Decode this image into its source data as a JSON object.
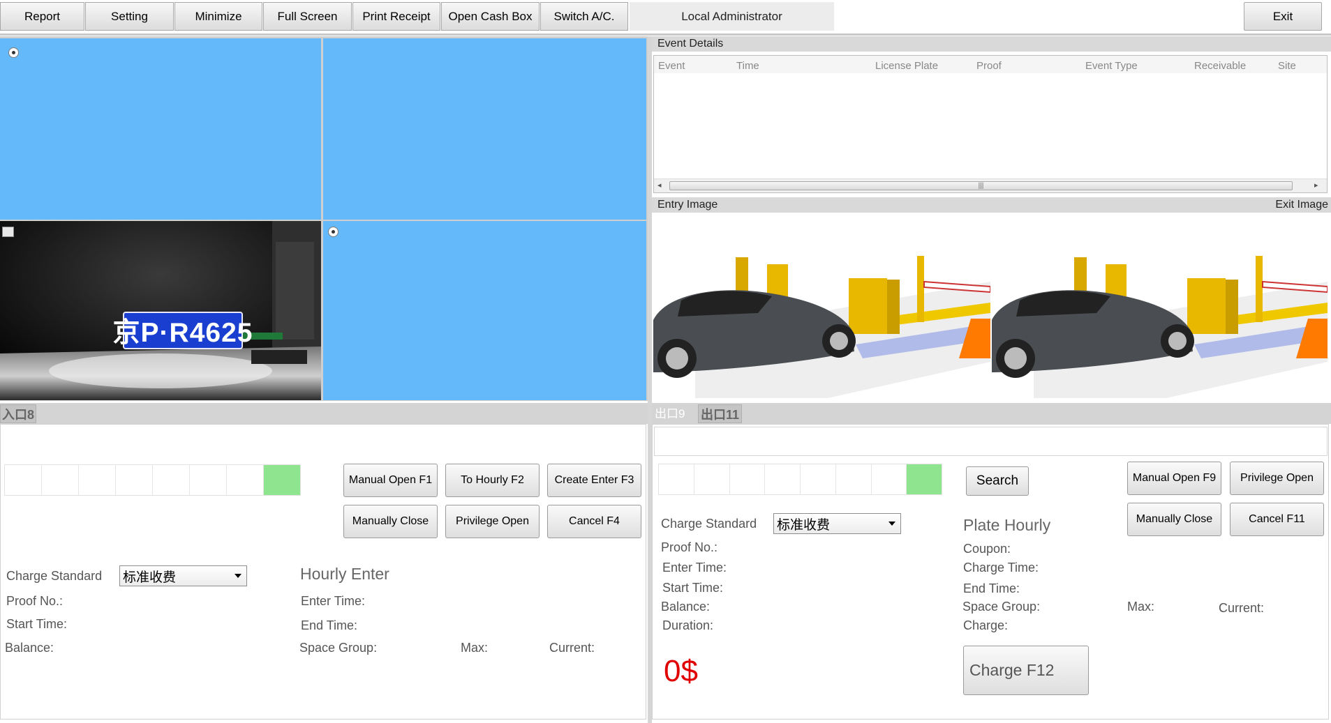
{
  "toolbar": {
    "report": "Report",
    "setting": "Setting",
    "minimize": "Minimize",
    "full_screen": "Full Screen",
    "print_receipt": "Print Receipt",
    "open_cash_box": "Open Cash Box",
    "switch_ac": "Switch A/C.",
    "user": "Local Administrator",
    "exit": "Exit"
  },
  "camera": {
    "plate_text": "京P·R4625"
  },
  "event_details": {
    "title": "Event Details",
    "columns": [
      "Event",
      "Time",
      "License Plate",
      "Proof",
      "Event Type",
      "Receivable",
      "Site"
    ],
    "rows": []
  },
  "images": {
    "entry_label": "Entry Image",
    "exit_label": "Exit Image"
  },
  "entry_panel": {
    "tab": "入口8",
    "buttons": {
      "manual_open": "Manual Open F1",
      "to_hourly": "To Hourly F2",
      "create_enter": "Create Enter F3",
      "manually_close": "Manually Close",
      "privilege_open": "Privilege Open",
      "cancel": "Cancel F4"
    },
    "charge_standard_label": "Charge Standard",
    "charge_standard_value": "标准收费",
    "proof_no": "Proof No.:",
    "start_time": "Start Time:",
    "balance": "Balance:",
    "mode": "Hourly Enter",
    "enter_time": "Enter Time:",
    "end_time": "End Time:",
    "space_group": "Space Group:",
    "max": "Max:",
    "current": "Current:"
  },
  "exit_panel": {
    "tab_active": "出口9",
    "tab_other": "出口11",
    "search": "Search",
    "buttons": {
      "manual_open": "Manual Open F9",
      "privilege_open": "Privilege Open",
      "manually_close": "Manually Close",
      "cancel": "Cancel F11",
      "charge": "Charge F12"
    },
    "charge_standard_label": "Charge Standard",
    "charge_standard_value": "标准收费",
    "proof_no": "Proof No.:",
    "enter_time": "Enter Time:",
    "start_time": "Start Time:",
    "balance": "Balance:",
    "duration": "Duration:",
    "mode": "Plate Hourly",
    "coupon": "Coupon:",
    "charge_time": "Charge Time:",
    "end_time": "End Time:",
    "space_group": "Space Group:",
    "charge": "Charge:",
    "max": "Max:",
    "current": "Current:",
    "amount": "0$"
  },
  "colors": {
    "camera_blue": "#64b9fa",
    "plate_green": "#8fe48f",
    "amount_red": "#e00000"
  }
}
